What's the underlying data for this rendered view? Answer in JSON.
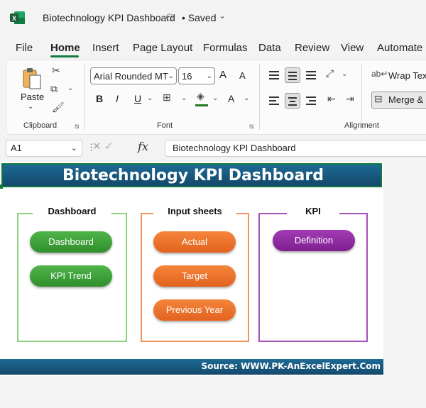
{
  "window": {
    "title": "Biotechnology KPI Dashboard",
    "saved_status": "• Saved",
    "app_icon": "excel-icon"
  },
  "menu": {
    "items": [
      "File",
      "Home",
      "Insert",
      "Page Layout",
      "Formulas",
      "Data",
      "Review",
      "View",
      "Automate"
    ],
    "active": "Home"
  },
  "ribbon": {
    "clipboard": {
      "paste_label": "Paste",
      "group_label": "Clipboard"
    },
    "font": {
      "name": "Arial Rounded MT",
      "size": "16",
      "group_label": "Font",
      "bold": "B",
      "italic": "I",
      "underline": "U",
      "grow": "A",
      "shrink": "A",
      "color_letter": "A"
    },
    "alignment": {
      "wrap_label": "Wrap Tex",
      "merge_label": "Merge &",
      "group_label": "Alignment"
    }
  },
  "formula_bar": {
    "name_box": "A1",
    "fx": "fx",
    "content": "Biotechnology KPI Dashboard"
  },
  "sheet": {
    "header_title": "Biotechnology KPI Dashboard",
    "panels": [
      {
        "title": "Dashboard",
        "color": "#8fd17f",
        "buttons": [
          "Dashboard",
          "KPI Trend"
        ],
        "button_color": "green"
      },
      {
        "title": "Input sheets",
        "color": "#f0945c",
        "buttons": [
          "Actual",
          "Target",
          "Previous Year"
        ],
        "button_color": "orange"
      },
      {
        "title": "KPI",
        "color": "#a54fb8",
        "buttons": [
          "Definition"
        ],
        "button_color": "purple"
      }
    ],
    "footer": "Source: WWW.PK-AnExcelExpert.Com"
  },
  "colors": {
    "accent_green": "#0f7b3f",
    "header_blue": "#1a5a82"
  }
}
